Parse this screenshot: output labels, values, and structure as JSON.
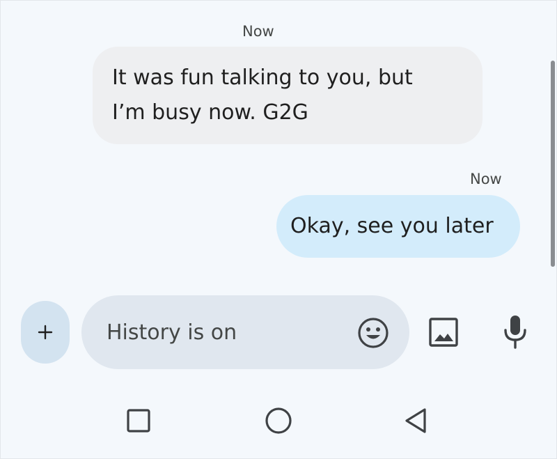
{
  "conversation": {
    "messages": [
      {
        "direction": "incoming",
        "timestamp": "Now",
        "lines": [
          "It was fun talking to you, but",
          "I’m busy now. G2G"
        ]
      },
      {
        "direction": "outgoing",
        "timestamp": "Now",
        "lines": [
          "Okay, see you later"
        ]
      }
    ]
  },
  "composer": {
    "add_button_label": "+",
    "placeholder": "History is on",
    "value": "",
    "icons": {
      "add": "plus-icon",
      "emoji": "emoji-icon",
      "gallery": "image-gallery-icon",
      "voice": "microphone-icon"
    }
  },
  "system_nav": {
    "icons": [
      "recents-square-icon",
      "home-circle-icon",
      "back-triangle-icon"
    ]
  },
  "colors": {
    "background": "#f4f8fc",
    "incoming_bubble": "#eeeff1",
    "outgoing_bubble": "#d3ecfb",
    "composer_background": "#e0e7ef",
    "add_button_background": "#d3e3f0",
    "icon": "#3f4245"
  }
}
